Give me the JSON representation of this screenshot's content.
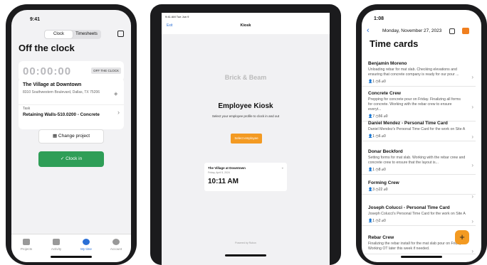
{
  "phone1": {
    "time": "9:41",
    "seg": [
      "Clock",
      "Timesheets"
    ],
    "title": "Off the clock",
    "timer": "00:00:00",
    "badge": "OFF THE CLOCK",
    "site": "The Village at Downtown",
    "address": "8310 Southwestern Boulevard, Dallas, TX 75206",
    "task_label": "Task",
    "task": "Retaining Walls-510.0200 - Concrete",
    "change": "Change project",
    "clockin": "✓  Clock in",
    "tabs": [
      "Projects",
      "Activity",
      "My time",
      "Account"
    ],
    "accent": "#2f9e57"
  },
  "tablet": {
    "status_left": "9:41 AM  Tue Jun 9",
    "exit": "Exit",
    "title": "Kiosk",
    "brand": "Brick & Beam",
    "heading": "Employee Kiosk",
    "sub": "Select your employee profile to clock in and out",
    "select": "Select employee",
    "site": "The Village at Downtown",
    "date": "Friday, April 5, 2024",
    "time": "10:11 AM",
    "footer": "Powered by  Rubon",
    "accent": "#f39a22"
  },
  "phone2": {
    "time": "1:08",
    "date": "Monday, November 27, 2023",
    "title": "Time cards",
    "fab": "+",
    "rows": [
      {
        "name": "Benjamin Moreno",
        "desc": "Unloading rebar for mat slab. Checking elevations and ensuring that concrete company is ready for our pour ...",
        "stats": "👤1   ◷6   ⌀0"
      },
      {
        "name": "Concrete Crew",
        "desc": "Prepping for concrete pour on Friday. Finalizing all forms for concrete. Working with the rebar crew to ensure everyt...",
        "stats": "👤7   ◷56   ⌀0"
      },
      {
        "name": "Daniel Mendez - Personal Time Card",
        "desc": "Daniel Mendez's Personal Time Card for the work on Site A",
        "stats": "👤1   ◷6   ⌀0"
      },
      {
        "name": "Donar Beckford",
        "desc": "Setting forms for mat slab. Working with the rebar crew and concrete crew to ensure that the layout is...",
        "stats": "👤1   ◷8   ⌀0"
      },
      {
        "name": "Forming Crew",
        "desc": "",
        "stats": "👤3   ◷22   ⌀0"
      },
      {
        "name": "Joseph Colucci - Personal Time Card",
        "desc": "Joseph Colucci's Personal Time Card for the work on Site A",
        "stats": "👤1   ◷2   ⌀0"
      },
      {
        "name": "Rebar Crew",
        "desc": "Finalizing the rebar install for the mat slab pour on Friday. Working OT later this week if needed.",
        "stats": ""
      }
    ]
  }
}
